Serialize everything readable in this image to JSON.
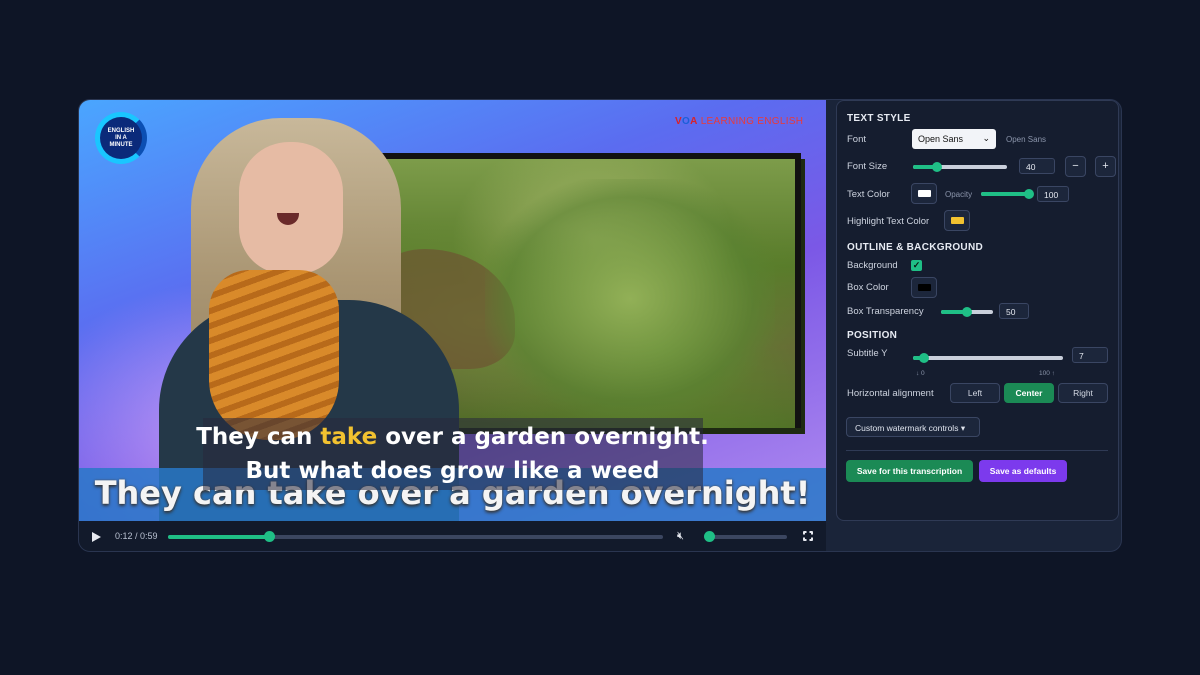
{
  "video": {
    "logo_text": "ENGLISH IN A MINUTE",
    "voa": {
      "v": "V",
      "o": "O",
      "a": "A",
      "learning": " LEARNING ENGLISH"
    },
    "burned_caption": "They can take over a garden overnight!",
    "subtitle": {
      "line1_before": "They can ",
      "line1_highlight": "take",
      "line1_after": " over a garden overnight.",
      "line2": "But what does grow like a weed"
    },
    "highlight_color": "#f2c230"
  },
  "player": {
    "time": "0:12 / 0:59",
    "progress": 0.205,
    "volume": 0.05,
    "accent": "#1fbf86"
  },
  "panel": {
    "text_style": {
      "heading": "TEXT STYLE",
      "font_label": "Font",
      "font_value": "Open Sans",
      "font_preview": "Open Sans",
      "font_size_label": "Font Size",
      "font_size_value": "40",
      "font_size_fraction": 0.26,
      "minus": "−",
      "plus": "+",
      "text_color_label": "Text Color",
      "text_color": "#ffffff",
      "opacity_label": "Opacity",
      "opacity_value": "100",
      "opacity_fraction": 1.0,
      "highlight_label": "Highlight Text Color",
      "highlight_color": "#f2c230"
    },
    "outline": {
      "heading": "OUTLINE & BACKGROUND",
      "background_label": "Background",
      "background_checked": true,
      "box_color_label": "Box Color",
      "box_color": "#000000",
      "transparency_label": "Box Transparency",
      "transparency_value": "50",
      "transparency_fraction": 0.5
    },
    "position": {
      "heading": "POSITION",
      "subtitle_y_label": "Subtitle Y",
      "subtitle_y_value": "7",
      "subtitle_y_fraction": 0.07,
      "min_label": "↓ 0",
      "max_label": "100 ↑",
      "halign_label": "Horizontal alignment",
      "align_left": "Left",
      "align_center": "Center",
      "align_right": "Right",
      "align_selected": "Center"
    },
    "watermark_button": "Custom watermark controls",
    "save_transcription": "Save for this transcription",
    "save_defaults": "Save as defaults"
  }
}
